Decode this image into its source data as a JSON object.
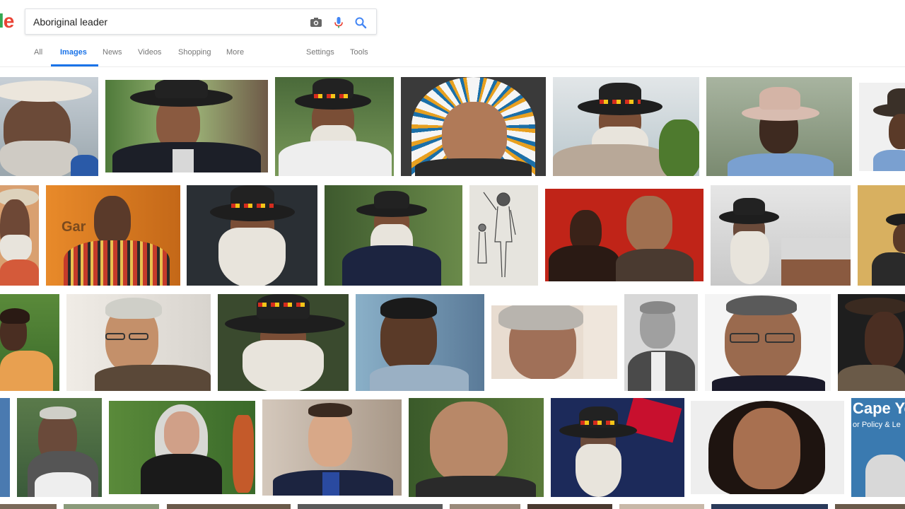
{
  "search": {
    "query": "Aboriginal leader"
  },
  "logo": {
    "l": "l",
    "e": "e"
  },
  "icons": {
    "camera": "camera-icon",
    "mic": "microphone-icon",
    "search": "search-icon"
  },
  "tabs": [
    {
      "label": "All",
      "active": false
    },
    {
      "label": "Images",
      "active": true
    },
    {
      "label": "News",
      "active": false
    },
    {
      "label": "Videos",
      "active": false
    },
    {
      "label": "Shopping",
      "active": false
    },
    {
      "label": "More",
      "active": false
    }
  ],
  "tools": [
    {
      "label": "Settings"
    },
    {
      "label": "Tools"
    }
  ],
  "thumbnail_texts": {
    "sign_cape": "Cape Yo",
    "sign_cape_sub": "or Policy & Le",
    "sign_gar": "Gar"
  },
  "colors": {
    "accent": "#1a73e8",
    "tab_text": "#777777"
  }
}
